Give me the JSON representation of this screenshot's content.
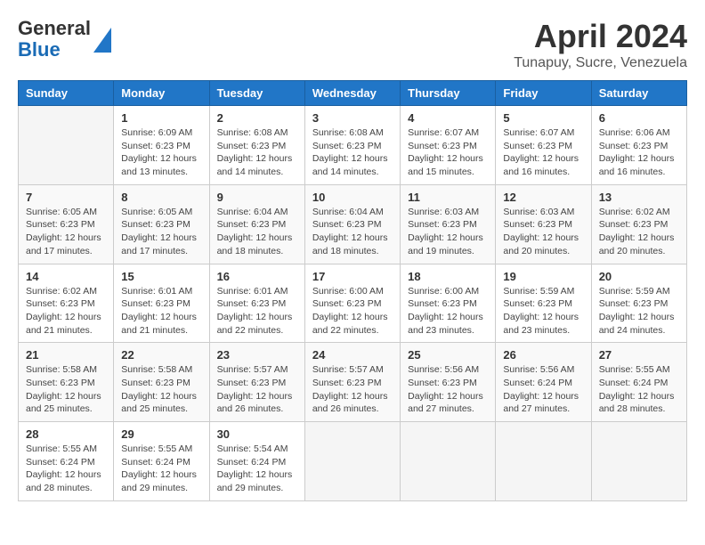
{
  "header": {
    "logo_line1": "General",
    "logo_line2": "Blue",
    "month": "April 2024",
    "location": "Tunapuy, Sucre, Venezuela"
  },
  "days_of_week": [
    "Sunday",
    "Monday",
    "Tuesday",
    "Wednesday",
    "Thursday",
    "Friday",
    "Saturday"
  ],
  "weeks": [
    [
      {
        "num": "",
        "info": ""
      },
      {
        "num": "1",
        "info": "Sunrise: 6:09 AM\nSunset: 6:23 PM\nDaylight: 12 hours\nand 13 minutes."
      },
      {
        "num": "2",
        "info": "Sunrise: 6:08 AM\nSunset: 6:23 PM\nDaylight: 12 hours\nand 14 minutes."
      },
      {
        "num": "3",
        "info": "Sunrise: 6:08 AM\nSunset: 6:23 PM\nDaylight: 12 hours\nand 14 minutes."
      },
      {
        "num": "4",
        "info": "Sunrise: 6:07 AM\nSunset: 6:23 PM\nDaylight: 12 hours\nand 15 minutes."
      },
      {
        "num": "5",
        "info": "Sunrise: 6:07 AM\nSunset: 6:23 PM\nDaylight: 12 hours\nand 16 minutes."
      },
      {
        "num": "6",
        "info": "Sunrise: 6:06 AM\nSunset: 6:23 PM\nDaylight: 12 hours\nand 16 minutes."
      }
    ],
    [
      {
        "num": "7",
        "info": "Sunrise: 6:05 AM\nSunset: 6:23 PM\nDaylight: 12 hours\nand 17 minutes."
      },
      {
        "num": "8",
        "info": "Sunrise: 6:05 AM\nSunset: 6:23 PM\nDaylight: 12 hours\nand 17 minutes."
      },
      {
        "num": "9",
        "info": "Sunrise: 6:04 AM\nSunset: 6:23 PM\nDaylight: 12 hours\nand 18 minutes."
      },
      {
        "num": "10",
        "info": "Sunrise: 6:04 AM\nSunset: 6:23 PM\nDaylight: 12 hours\nand 18 minutes."
      },
      {
        "num": "11",
        "info": "Sunrise: 6:03 AM\nSunset: 6:23 PM\nDaylight: 12 hours\nand 19 minutes."
      },
      {
        "num": "12",
        "info": "Sunrise: 6:03 AM\nSunset: 6:23 PM\nDaylight: 12 hours\nand 20 minutes."
      },
      {
        "num": "13",
        "info": "Sunrise: 6:02 AM\nSunset: 6:23 PM\nDaylight: 12 hours\nand 20 minutes."
      }
    ],
    [
      {
        "num": "14",
        "info": "Sunrise: 6:02 AM\nSunset: 6:23 PM\nDaylight: 12 hours\nand 21 minutes."
      },
      {
        "num": "15",
        "info": "Sunrise: 6:01 AM\nSunset: 6:23 PM\nDaylight: 12 hours\nand 21 minutes."
      },
      {
        "num": "16",
        "info": "Sunrise: 6:01 AM\nSunset: 6:23 PM\nDaylight: 12 hours\nand 22 minutes."
      },
      {
        "num": "17",
        "info": "Sunrise: 6:00 AM\nSunset: 6:23 PM\nDaylight: 12 hours\nand 22 minutes."
      },
      {
        "num": "18",
        "info": "Sunrise: 6:00 AM\nSunset: 6:23 PM\nDaylight: 12 hours\nand 23 minutes."
      },
      {
        "num": "19",
        "info": "Sunrise: 5:59 AM\nSunset: 6:23 PM\nDaylight: 12 hours\nand 23 minutes."
      },
      {
        "num": "20",
        "info": "Sunrise: 5:59 AM\nSunset: 6:23 PM\nDaylight: 12 hours\nand 24 minutes."
      }
    ],
    [
      {
        "num": "21",
        "info": "Sunrise: 5:58 AM\nSunset: 6:23 PM\nDaylight: 12 hours\nand 25 minutes."
      },
      {
        "num": "22",
        "info": "Sunrise: 5:58 AM\nSunset: 6:23 PM\nDaylight: 12 hours\nand 25 minutes."
      },
      {
        "num": "23",
        "info": "Sunrise: 5:57 AM\nSunset: 6:23 PM\nDaylight: 12 hours\nand 26 minutes."
      },
      {
        "num": "24",
        "info": "Sunrise: 5:57 AM\nSunset: 6:23 PM\nDaylight: 12 hours\nand 26 minutes."
      },
      {
        "num": "25",
        "info": "Sunrise: 5:56 AM\nSunset: 6:23 PM\nDaylight: 12 hours\nand 27 minutes."
      },
      {
        "num": "26",
        "info": "Sunrise: 5:56 AM\nSunset: 6:24 PM\nDaylight: 12 hours\nand 27 minutes."
      },
      {
        "num": "27",
        "info": "Sunrise: 5:55 AM\nSunset: 6:24 PM\nDaylight: 12 hours\nand 28 minutes."
      }
    ],
    [
      {
        "num": "28",
        "info": "Sunrise: 5:55 AM\nSunset: 6:24 PM\nDaylight: 12 hours\nand 28 minutes."
      },
      {
        "num": "29",
        "info": "Sunrise: 5:55 AM\nSunset: 6:24 PM\nDaylight: 12 hours\nand 29 minutes."
      },
      {
        "num": "30",
        "info": "Sunrise: 5:54 AM\nSunset: 6:24 PM\nDaylight: 12 hours\nand 29 minutes."
      },
      {
        "num": "",
        "info": ""
      },
      {
        "num": "",
        "info": ""
      },
      {
        "num": "",
        "info": ""
      },
      {
        "num": "",
        "info": ""
      }
    ]
  ]
}
